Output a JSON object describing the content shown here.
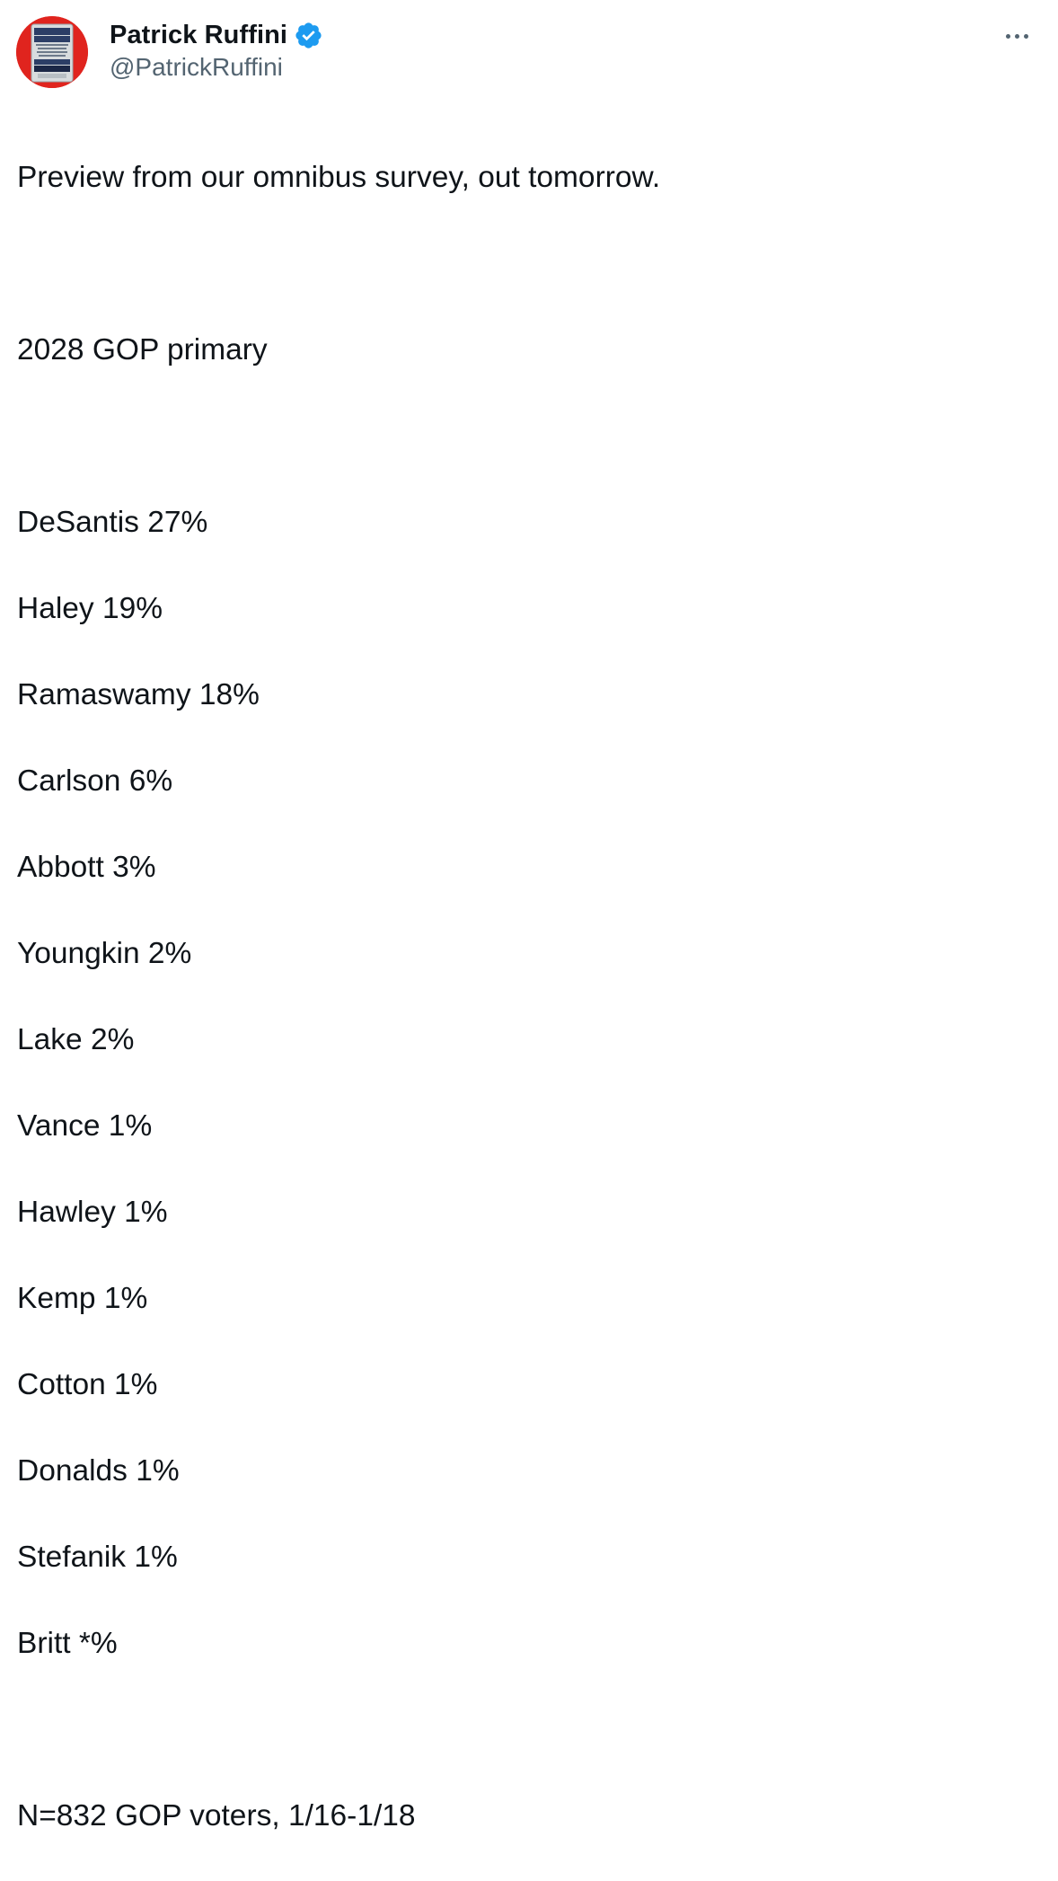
{
  "author": {
    "display_name": "Patrick Ruffini",
    "handle": "@PatrickRuffini",
    "verified": true,
    "avatar": {
      "icon": "book-cover-avatar",
      "book_title": "PARTY OF THE PEOPLE",
      "book_author": "PATRICK RUFFINI",
      "accent_color": "#e0241e"
    }
  },
  "menu": {
    "icon": "more-options-icon"
  },
  "tweet": {
    "intro": "Preview from our omnibus survey, out tomorrow.",
    "heading": "2028 GOP primary",
    "results": [
      "DeSantis 27%",
      "Haley 19%",
      "Ramaswamy 18%",
      "Carlson 6%",
      "Abbott 3%",
      "Youngkin 2%",
      "Lake 2%",
      "Vance 1%",
      "Hawley 1%",
      "Kemp 1%",
      "Cotton 1%",
      "Donalds 1%",
      "Stefanik 1%",
      "Britt *%"
    ],
    "footer": "N=832 GOP voters, 1/16-1/18"
  },
  "colors": {
    "text": "#0f1419",
    "secondary": "#536471",
    "verified_badge": "#1d9bf0"
  }
}
